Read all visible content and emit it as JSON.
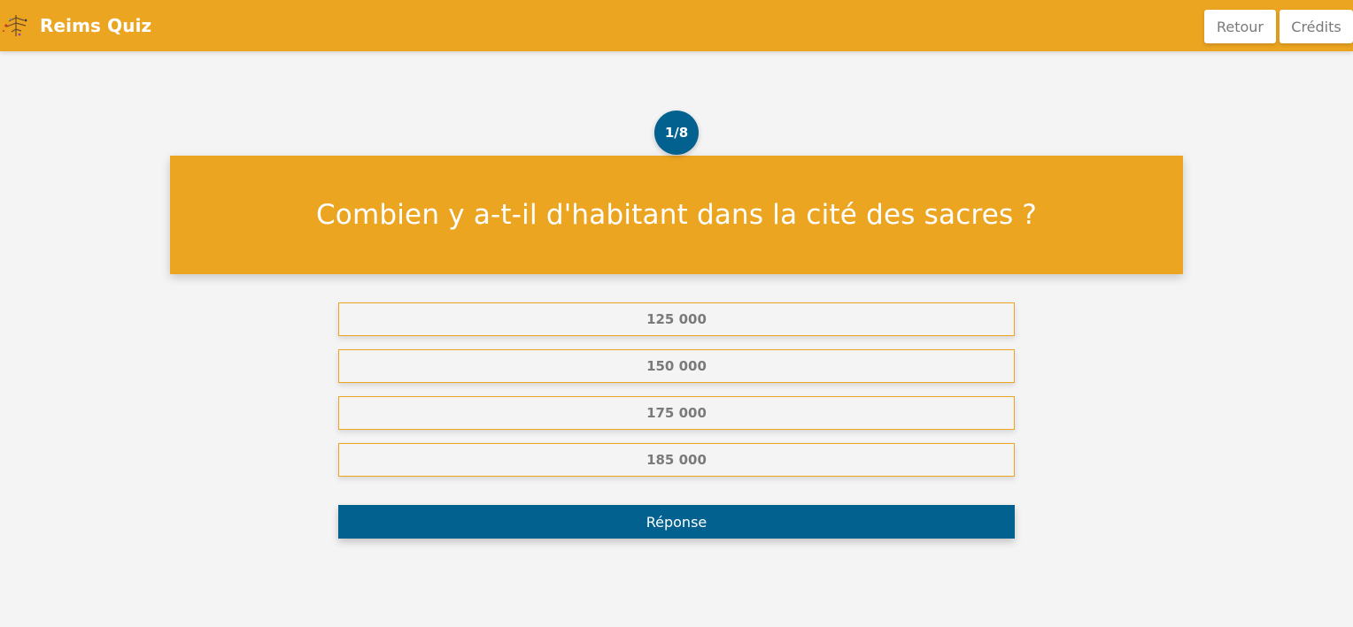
{
  "navbar": {
    "brand_text": "Reims Quiz",
    "brand_logo_icon": "cathedral-logo-icon",
    "retour_label": "Retour",
    "credits_label": "Crédits",
    "background_color": "#eca521"
  },
  "quiz": {
    "counter": "1/8",
    "question": "Combien y a-t-il d'habitant dans la cité des sacres ?",
    "answers": [
      {
        "label": "125 000"
      },
      {
        "label": "150 000"
      },
      {
        "label": "175 000"
      },
      {
        "label": "185 000"
      }
    ],
    "submit_label": "Réponse",
    "accent_color": "#02618f"
  }
}
